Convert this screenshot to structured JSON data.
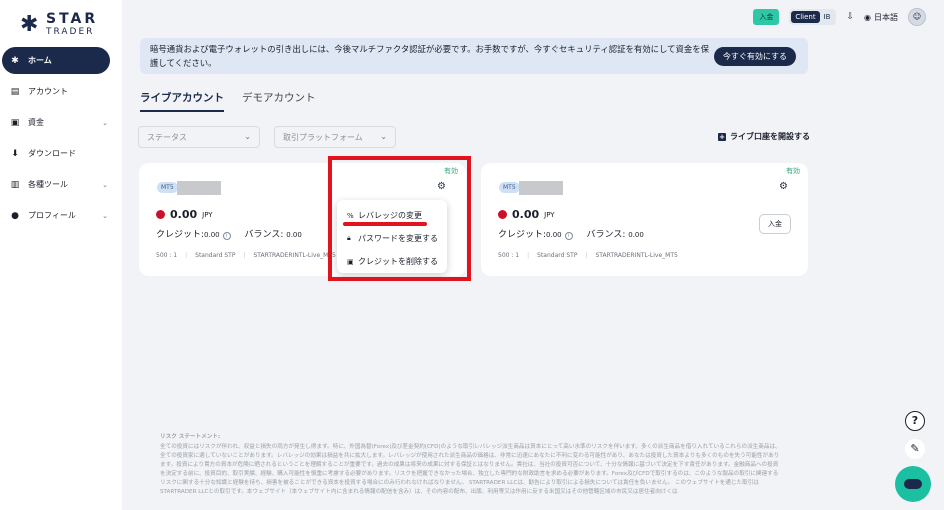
{
  "logo": {
    "main": "STAR",
    "sub": "TRADER"
  },
  "sidebar": {
    "items": [
      {
        "label": "ホーム",
        "icon": "star-icon",
        "glyph": "✱",
        "active": true,
        "chevron": false
      },
      {
        "label": "アカウント",
        "icon": "document-icon",
        "glyph": "▤",
        "active": false,
        "chevron": false
      },
      {
        "label": "資金",
        "icon": "wallet-icon",
        "glyph": "▣",
        "active": false,
        "chevron": true
      },
      {
        "label": "ダウンロード",
        "icon": "download-icon",
        "glyph": "⬇",
        "active": false,
        "chevron": false
      },
      {
        "label": "各種ツール",
        "icon": "toolbox-icon",
        "glyph": "▥",
        "active": false,
        "chevron": true
      },
      {
        "label": "プロフィール",
        "icon": "user-icon",
        "glyph": "●",
        "active": false,
        "chevron": true
      }
    ]
  },
  "topbar": {
    "deposit": "入金",
    "client": "Client",
    "ib": "IB",
    "language": "日本語"
  },
  "notice": {
    "text": "暗号通貨および電子ウォレットの引き出しには、今後マルチファクタ認証が必要です。お手数ですが、今すぐセキュリティ認証を有効にして資金を保護してください。",
    "button": "今すぐ有効にする"
  },
  "tabs": [
    {
      "label": "ライブアカウント",
      "active": true
    },
    {
      "label": "デモアカウント",
      "active": false
    }
  ],
  "filters": {
    "status": "ステータス",
    "platform": "取引プラットフォーム",
    "open_live": "ライブ口座を開設する"
  },
  "cards": [
    {
      "status": "有効",
      "platform_badge": "MT5",
      "balance": "0.00",
      "currency": "JPY",
      "credit_label": "クレジット:",
      "credit_value": "0.00",
      "balance_label": "バランス:",
      "balance_value": "0.00",
      "leverage": "500 : 1",
      "account_type": "Standard STP",
      "server": "STARTRADERINTL-Live_MT5"
    },
    {
      "status": "有効",
      "platform_badge": "MT5",
      "balance": "0.00",
      "currency": "JPY",
      "credit_label": "クレジット:",
      "credit_value": "0.00",
      "balance_label": "バランス:",
      "balance_value": "0.00",
      "leverage": "500 : 1",
      "account_type": "Standard STP",
      "server": "STARTRADERINTL-Live_MT5",
      "deposit": "入金"
    }
  ],
  "menu": {
    "change_leverage": "レバレッジの変更",
    "change_password": "パスワードを変更する",
    "delete_credit": "クレジットを削除する"
  },
  "risk": {
    "title": "リスク ステートメント:",
    "body": "全ての投資にはリスクが伴われ、収益と損失の両方が発生し得ます。特に、外国為替(Forex)及び差金契約(CFD)のような取引レバレッジ派生商品は資本にとって高い水準のリスクを伴います。多くの派生商品を借り入れているこれらの派生商品は、全ての投資家に適していないことがあります。レバレッジの効果は損益を共に拡大します。レバレッジが使用された派生商品の価格は、非常に迅速にあなたに不利に変わる可能性があり、あなたは投資した資本よりも多くのものを失う可能性があります。投資により貴方の資本が危険に晒されるということを理解することが重要です。過去の成果は将来の成果に対する保証とはなりません。貴社は、当社の投資可否について、十分な情報に基づいて決定を下す責任があります。金融商品への投資を決定する前に、投資目的、取引実績、経験、購入可能性を慎重に考慮する必要があります。リスクを把握できなかった場合、独立した専門的な財政助言を求める必要があります。Forex及びCFDで取引するのは、このような製品の取引に関連するリスクに関する十分な知識と経験を持ち、損害を被ることができる資本を投資する場合にのみ行われなければなりません。 STARTRADER LLCは、勧告により取引による損失については責任を負いません。 このウェブサイトを通じた取引はSTARTRADER LLCとの取引です。本ウェブサイト（本ウェブサイト内に含まれる情報の配信を含み）は、その内容の配布、出版、利用等又は作用に反する米国又はその他管轄区域の市民又は居住者向けくは"
  }
}
